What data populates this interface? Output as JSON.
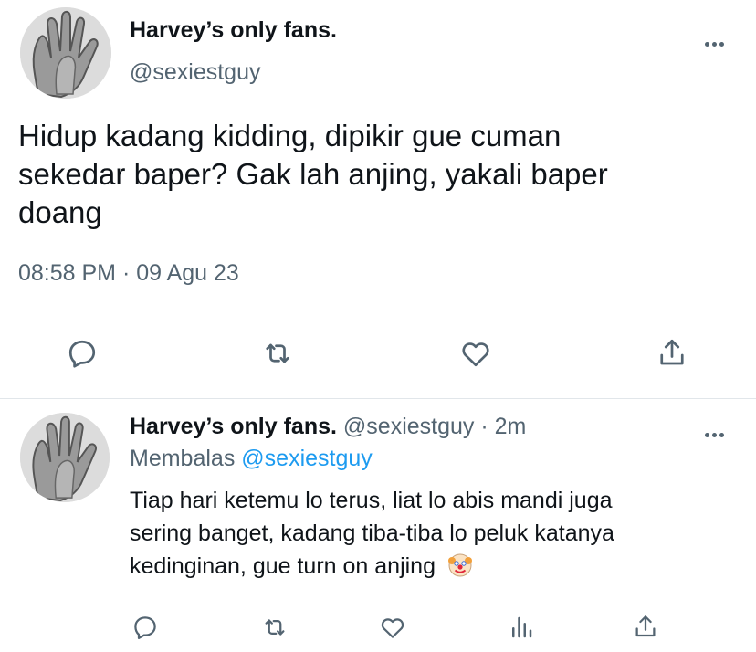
{
  "tweet": {
    "display_name": "Harvey’s only fans.",
    "handle": "@sexiestguy",
    "text_lines": [
      "Hidup kadang kidding, dipikir gue cuman",
      "sekedar baper? Gak lah anjing, yakali baper",
      "doang"
    ],
    "timestamp": "08:58 PM · 09 Agu 23",
    "actions": [
      "reply-icon",
      "retweet-icon",
      "like-icon",
      "share-icon"
    ]
  },
  "reply": {
    "display_name": "Harvey’s only fans.",
    "handle": "@sexiestguy",
    "time": "· 2m",
    "replying_to_label": "Membalas",
    "replying_to_handle": "@sexiestguy",
    "text_lines": [
      "Tiap hari ketemu lo terus, liat lo abis mandi juga",
      "sering banget, kadang tiba-tiba lo peluk katanya",
      "kedinginan, gue turn on anjing"
    ],
    "emoji": "clown-face",
    "actions": [
      "reply-icon",
      "retweet-icon",
      "like-icon",
      "views-icon",
      "share-icon"
    ]
  },
  "colors": {
    "text": "#0f1419",
    "secondary": "#536471",
    "link": "#1d9bf0",
    "divider": "#e1e6ea"
  }
}
